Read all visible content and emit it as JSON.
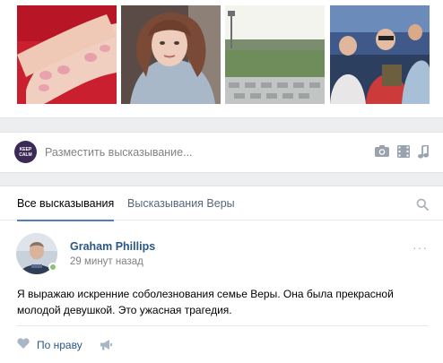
{
  "photos": [
    {
      "subject": "manicured hands with pink nails"
    },
    {
      "subject": "young woman portrait"
    },
    {
      "subject": "football stadium"
    },
    {
      "subject": "fans in stadium stands"
    }
  ],
  "composer": {
    "avatar_text": "KEEP CALM",
    "placeholder": "Разместить высказывание...",
    "icons": [
      "camera-icon",
      "video-icon",
      "music-icon"
    ]
  },
  "feed": {
    "tabs": [
      {
        "label": "Все высказывания",
        "active": true
      },
      {
        "label": "Высказывания Веры",
        "active": false
      }
    ]
  },
  "post": {
    "author": "Graham Phillips",
    "time": "29 минут назад",
    "text": "Я выражаю искренние соболезнования семье Веры. Она была прекрасной молодой девушкой. Это ужасная трагедия.",
    "like_label": "По нраву",
    "online": true
  },
  "colors": {
    "accent": "#5181b8",
    "link": "#2a5885",
    "secondary_text": "#828282",
    "background": "#edeef0",
    "online": "#8ac176"
  }
}
